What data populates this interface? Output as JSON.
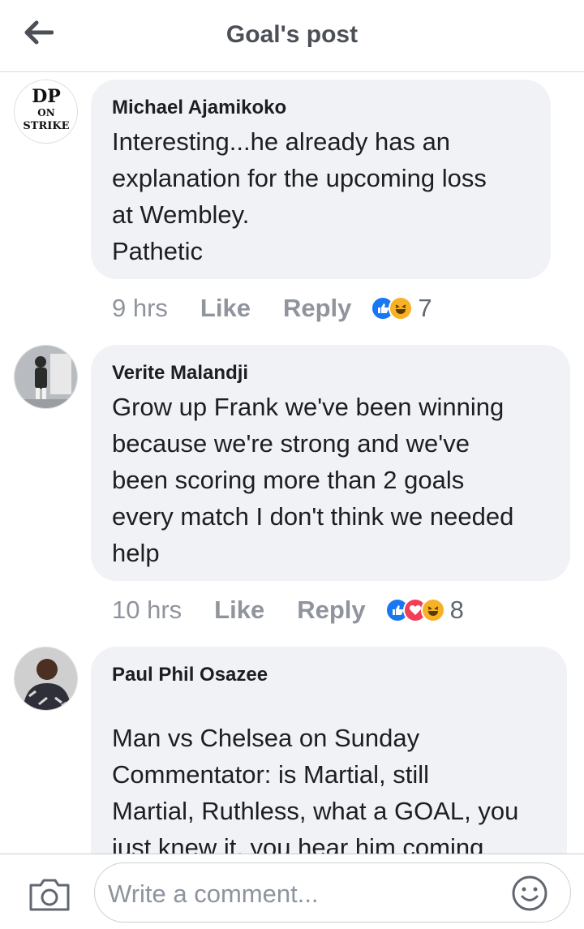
{
  "header": {
    "title": "Goal's post"
  },
  "comments": [
    {
      "author": "Michael Ajamikoko",
      "avatar_text": {
        "line1": "DP",
        "line2": "ON",
        "line3": "STRIKE"
      },
      "text": "Interesting...he already has an\nexplanation for the upcoming loss\nat Wembley.\nPathetic",
      "time": "9 hrs",
      "like": "Like",
      "reply": "Reply",
      "reactions": [
        "like-icon",
        "haha-icon"
      ],
      "reaction_count": "7"
    },
    {
      "author": "Verite Malandji",
      "text": "Grow up Frank we've been winning\nbecause we're strong and we've\nbeen scoring more than 2 goals\nevery match I don't think we needed\nhelp",
      "time": "10 hrs",
      "like": "Like",
      "reply": "Reply",
      "reactions": [
        "like-icon",
        "love-icon",
        "haha-icon"
      ],
      "reaction_count": "8"
    },
    {
      "author": "Paul Phil Osazee",
      "text": "Man vs Chelsea on Sunday\nCommentator: is Martial, still\nMartial, Ruthless, what a GOAL, you\njust knew it, you hear him coming"
    }
  ],
  "composer": {
    "placeholder": "Write a comment..."
  },
  "colors": {
    "like": "#1877f2",
    "love": "#f33e58",
    "haha": "#f7b125",
    "bubble": "#f0f2f5"
  }
}
